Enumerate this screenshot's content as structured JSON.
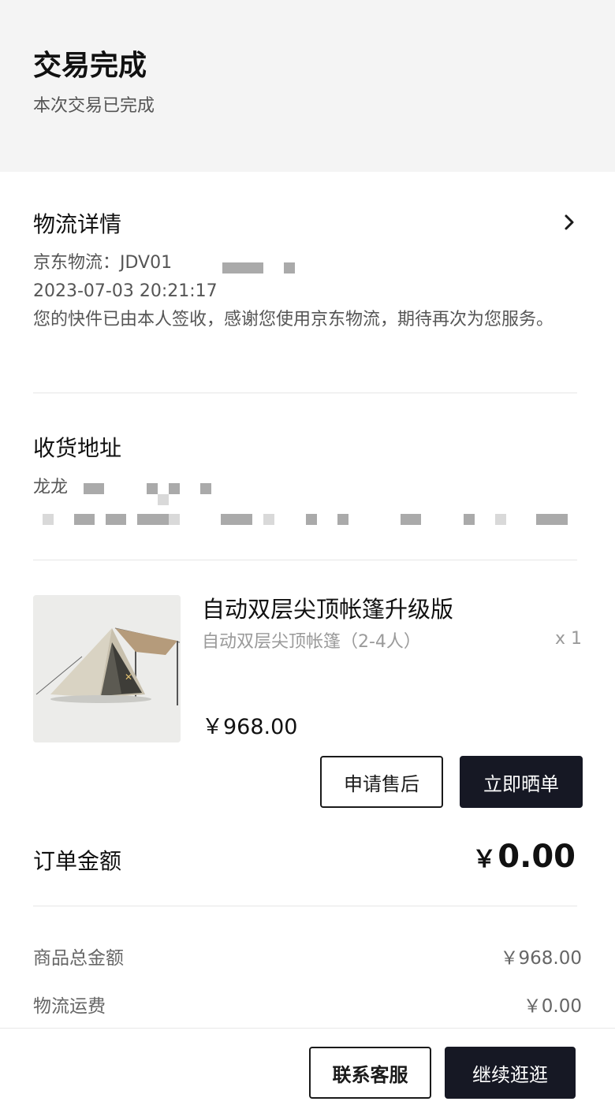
{
  "status": {
    "title": "交易完成",
    "subtitle": "本次交易已完成"
  },
  "logistics": {
    "title": "物流详情",
    "carrier_line": "京东物流：JDV01",
    "timestamp": "2023-07-03 20:21:17",
    "message": "您的快件已由本人签收，感谢您使用京东物流，期待再次为您服务。",
    "icon": "chevron-right-icon"
  },
  "address": {
    "title": "收货地址",
    "name_visible": "龙龙"
  },
  "product": {
    "name": "自动双层尖顶帐篷升级版",
    "spec": "自动双层尖顶帐篷（2-4人）",
    "quantity": "x 1",
    "price": "￥968.00",
    "aftersale_label": "申请售后",
    "review_label": "立即晒单"
  },
  "order": {
    "label": "订单金额",
    "currency": "￥",
    "amount": "0.00",
    "goods_total_label": "商品总金额",
    "goods_total_value": "￥968.00",
    "shipping_label": "物流运费",
    "shipping_value": "￥0.00"
  },
  "bottom_bar": {
    "service_label": "联系客服",
    "continue_label": "继续逛逛"
  },
  "colors": {
    "banner_bg": "#f4f4f4",
    "primary_dark": "#161824",
    "text_secondary": "#555555"
  }
}
